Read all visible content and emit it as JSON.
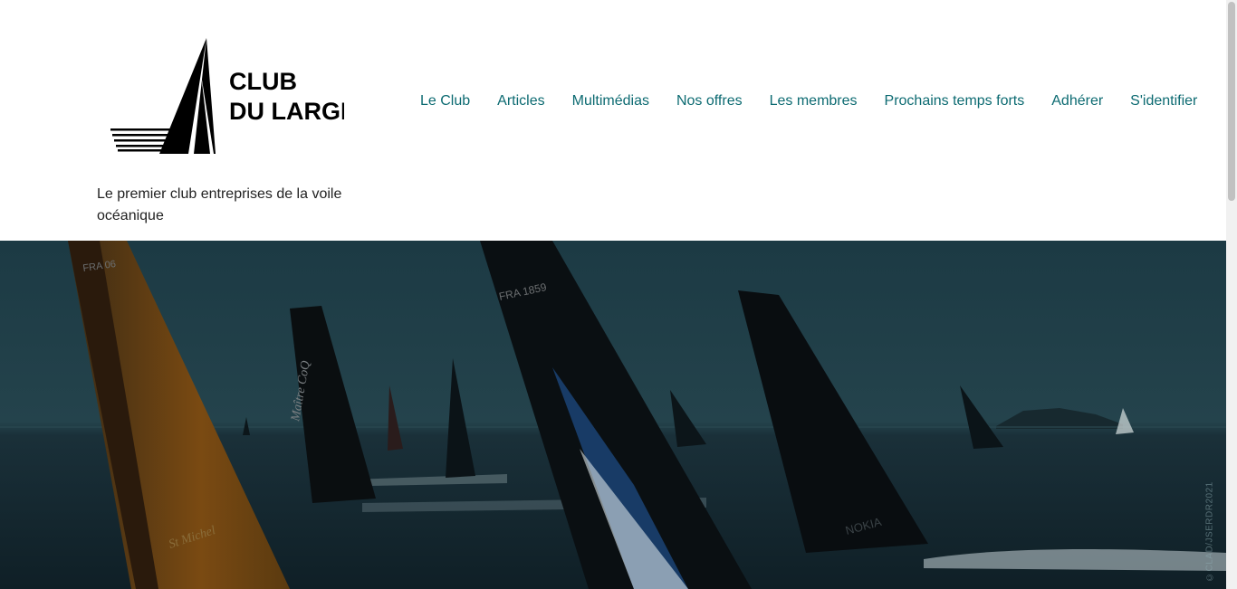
{
  "site": {
    "logo_line1": "CLUB",
    "logo_line2": "DU LARGE",
    "tagline": "Le premier club entreprises de la voile océanique"
  },
  "nav": {
    "items": [
      {
        "label": "Le Club"
      },
      {
        "label": "Articles"
      },
      {
        "label": "Multimédias"
      },
      {
        "label": "Nos offres"
      },
      {
        "label": "Les membres"
      },
      {
        "label": "Prochains temps forts"
      },
      {
        "label": "Adhérer"
      },
      {
        "label": "S'identifier"
      }
    ]
  },
  "hero": {
    "photo_credit": "©CLAD/JSERDR2021",
    "sail_marks": [
      "FRA 06",
      "FRA 1859",
      "Maître CoQ",
      "St Michel",
      "NOKIA"
    ]
  },
  "colors": {
    "nav_link": "#0d6b72",
    "text": "#222222",
    "hero_tint": "#1e3b44"
  }
}
